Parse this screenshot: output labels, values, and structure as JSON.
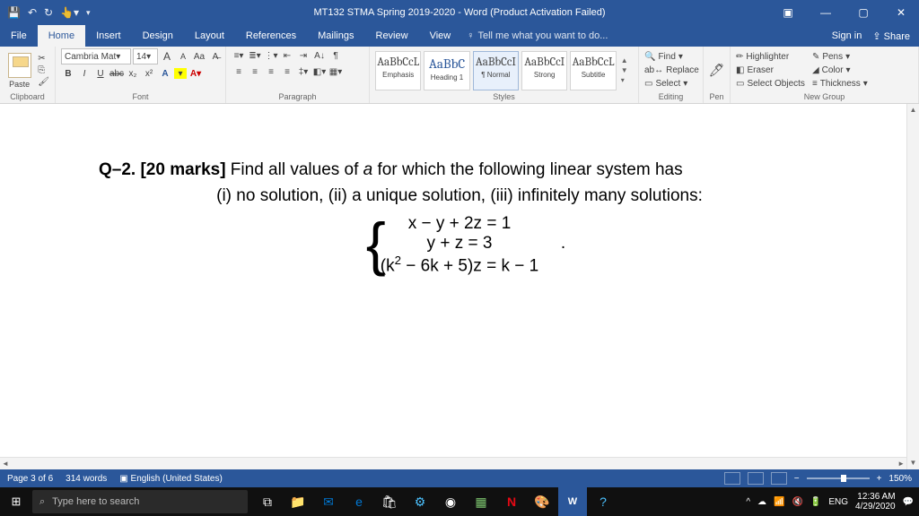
{
  "titlebar": {
    "title": "MT132 STMA Spring 2019-2020 - Word (Product Activation Failed)"
  },
  "tabs": {
    "file": "File",
    "home": "Home",
    "insert": "Insert",
    "design": "Design",
    "layout": "Layout",
    "references": "References",
    "mailings": "Mailings",
    "review": "Review",
    "view": "View",
    "tellme": "Tell me what you want to do...",
    "signin": "Sign in",
    "share": "Share"
  },
  "ribbon": {
    "clipboard": {
      "label": "Clipboard",
      "paste": "Paste"
    },
    "font": {
      "label": "Font",
      "name": "Cambria Mat",
      "size": "14",
      "grow": "A",
      "shrink": "A",
      "case": "Aa",
      "bold": "B",
      "italic": "I",
      "underline": "U",
      "strike": "abc",
      "sub": "x₂",
      "sup": "x²",
      "txteffect": "A"
    },
    "paragraph": {
      "label": "Paragraph"
    },
    "styles": {
      "label": "Styles",
      "items": [
        {
          "sample": "AaBbCcL",
          "name": "Emphasis"
        },
        {
          "sample": "AaBbC",
          "name": "Heading 1"
        },
        {
          "sample": "AaBbCcI",
          "name": "¶ Normal"
        },
        {
          "sample": "AaBbCcI",
          "name": "Strong"
        },
        {
          "sample": "AaBbCcL",
          "name": "Subtitle"
        }
      ]
    },
    "editing": {
      "label": "Editing",
      "find": "Find",
      "replace": "Replace",
      "select": "Select"
    },
    "pen": {
      "label": "Pen"
    },
    "newgroup": {
      "label": "New Group",
      "highlighter": "Highlighter",
      "eraser": "Eraser",
      "selobj": "Select Objects",
      "pens": "Pens",
      "color": "Color",
      "thickness": "Thickness"
    }
  },
  "document": {
    "q_label": "Q–2. [20 marks]",
    "q_text1": " Find all values of ",
    "q_var": "a",
    "q_text2": " for which the following linear system has",
    "q_line2": "(i) no solution, (ii) a unique solution, (iii) infinitely many solutions:",
    "eq1": "x − y + 2z = 1",
    "eq2": "y + z = 3",
    "eq3a": "(k",
    "eq3b": " − 6k + 5)z = k − 1",
    "dot": "."
  },
  "status": {
    "page": "Page 3 of 6",
    "words": "314 words",
    "lang": "English (United States)",
    "zoom": "150%"
  },
  "taskbar": {
    "search": "Type here to search",
    "lang": "ENG",
    "time": "12:36 AM",
    "date": "4/29/2020"
  }
}
